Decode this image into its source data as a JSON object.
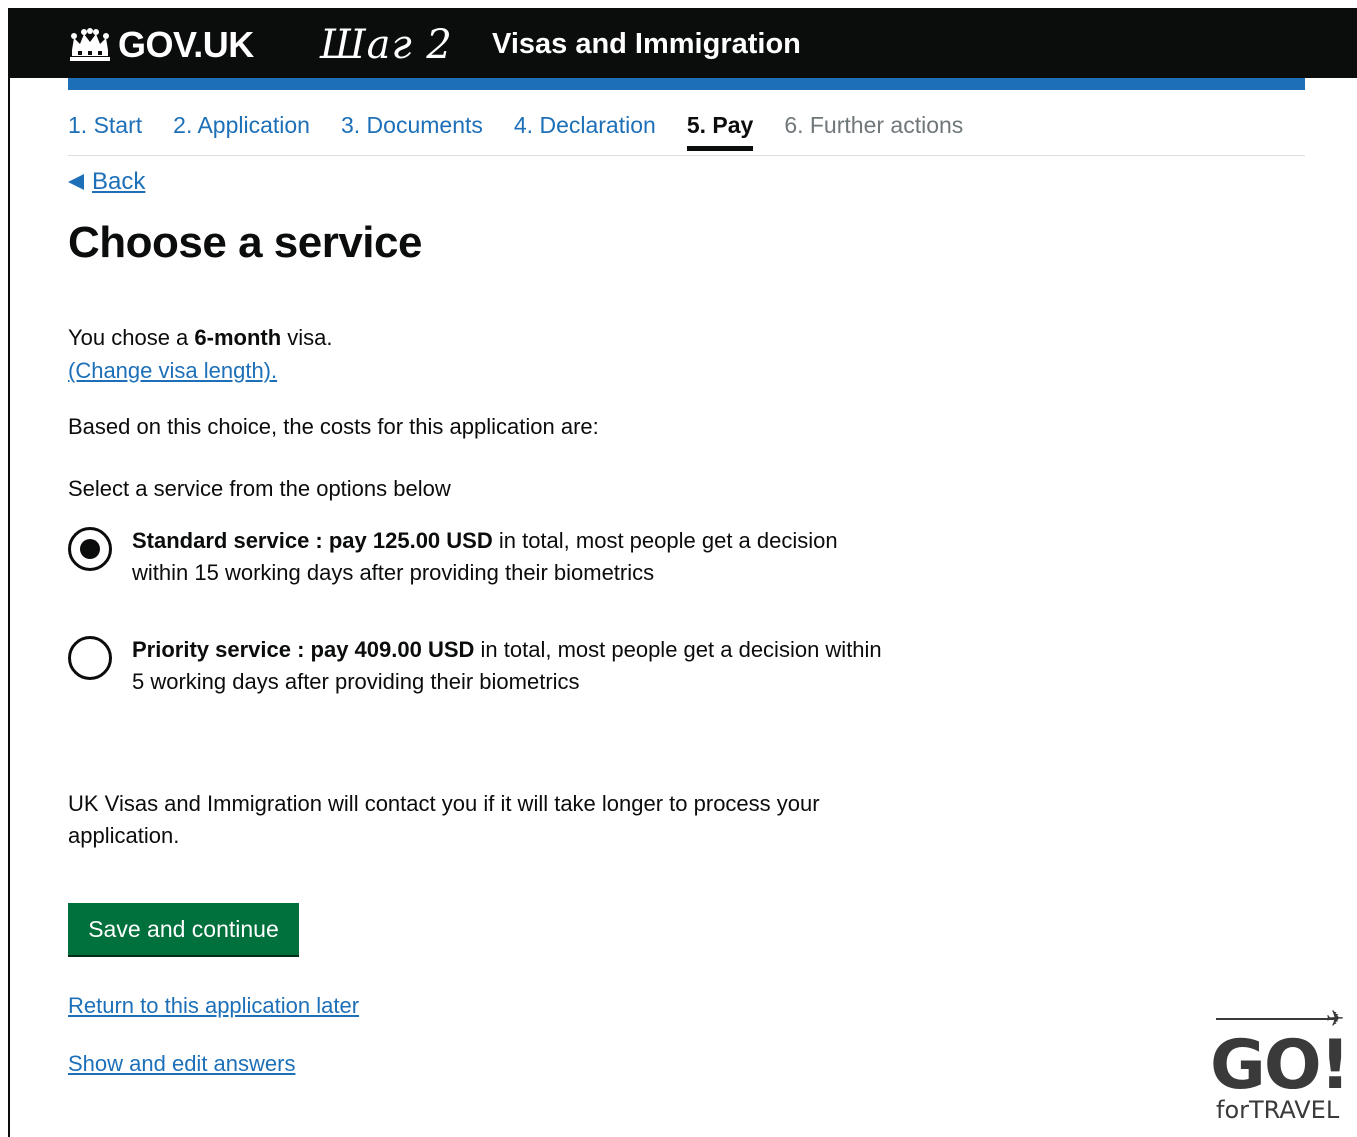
{
  "header": {
    "logo_text": "GOV.UK",
    "step_annotation": "Шаг 2",
    "service_name": "Visas and Immigration",
    "bar_color": "#1d70b8",
    "background_color": "#0b0c0c"
  },
  "steps": [
    {
      "label": "1. Start",
      "state": "link"
    },
    {
      "label": "2. Application",
      "state": "link"
    },
    {
      "label": "3. Documents",
      "state": "link"
    },
    {
      "label": "4. Declaration",
      "state": "link"
    },
    {
      "label": "5. Pay",
      "state": "current"
    },
    {
      "label": "6. Further actions",
      "state": "disabled"
    }
  ],
  "back": {
    "label": "Back",
    "icon": "triangle-left-icon"
  },
  "page_title": "Choose a service",
  "visa_choice": {
    "prefix": "You chose a ",
    "length": "6-month",
    "suffix": " visa.",
    "change_link": "(Change visa length)."
  },
  "costs_intro": "Based on this choice, the costs for this application are:",
  "select_prompt": "Select a service from the options below",
  "options": [
    {
      "bold": "Standard service : pay 125.00 USD",
      "rest": " in total, most people get a decision within 15 working days after providing their biometrics",
      "checked": true
    },
    {
      "bold": "Priority service : pay 409.00 USD",
      "rest": " in total, most people get a decision within 5 working days after providing their biometrics",
      "checked": false
    }
  ],
  "contact_note": "UK Visas and Immigration will contact you if it will take longer to process your application.",
  "primary_button": {
    "label": "Save and continue",
    "color": "#00703c"
  },
  "links": {
    "return_later": "Return to this application later",
    "show_edit": "Show and edit answers"
  },
  "watermark": {
    "go": "GO!",
    "sub": "forTRAVEL",
    "icon": "airplane-icon"
  }
}
